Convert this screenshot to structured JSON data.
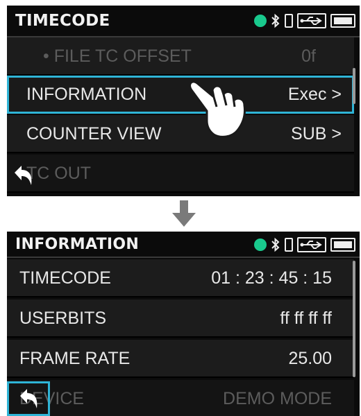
{
  "top_screen": {
    "title": "TIMECODE",
    "rows": [
      {
        "label": "• FILE TC OFFSET",
        "value": "0f"
      },
      {
        "label": "INFORMATION",
        "value": "Exec >"
      },
      {
        "label": "COUNTER VIEW",
        "value": "SUB >"
      },
      {
        "label": "TC OUT",
        "value": ""
      }
    ]
  },
  "bottom_screen": {
    "title": "INFORMATION",
    "rows": [
      {
        "label": "TIMECODE",
        "value": "01 : 23 : 45 : 15"
      },
      {
        "label": "USERBITS",
        "value": "ff ff ff ff"
      },
      {
        "label": "FRAME RATE",
        "value": "25.00"
      },
      {
        "label": "DEVICE",
        "value": "DEMO MODE"
      }
    ]
  },
  "status_icons": [
    "status-dot-icon",
    "bluetooth-icon",
    "phone-icon",
    "usb-icon",
    "battery-icon"
  ],
  "colors": {
    "accent": "#2fb4d6",
    "status_dot": "#19c98d",
    "background": "#0b0b0b",
    "row": "#1c1c1c"
  }
}
